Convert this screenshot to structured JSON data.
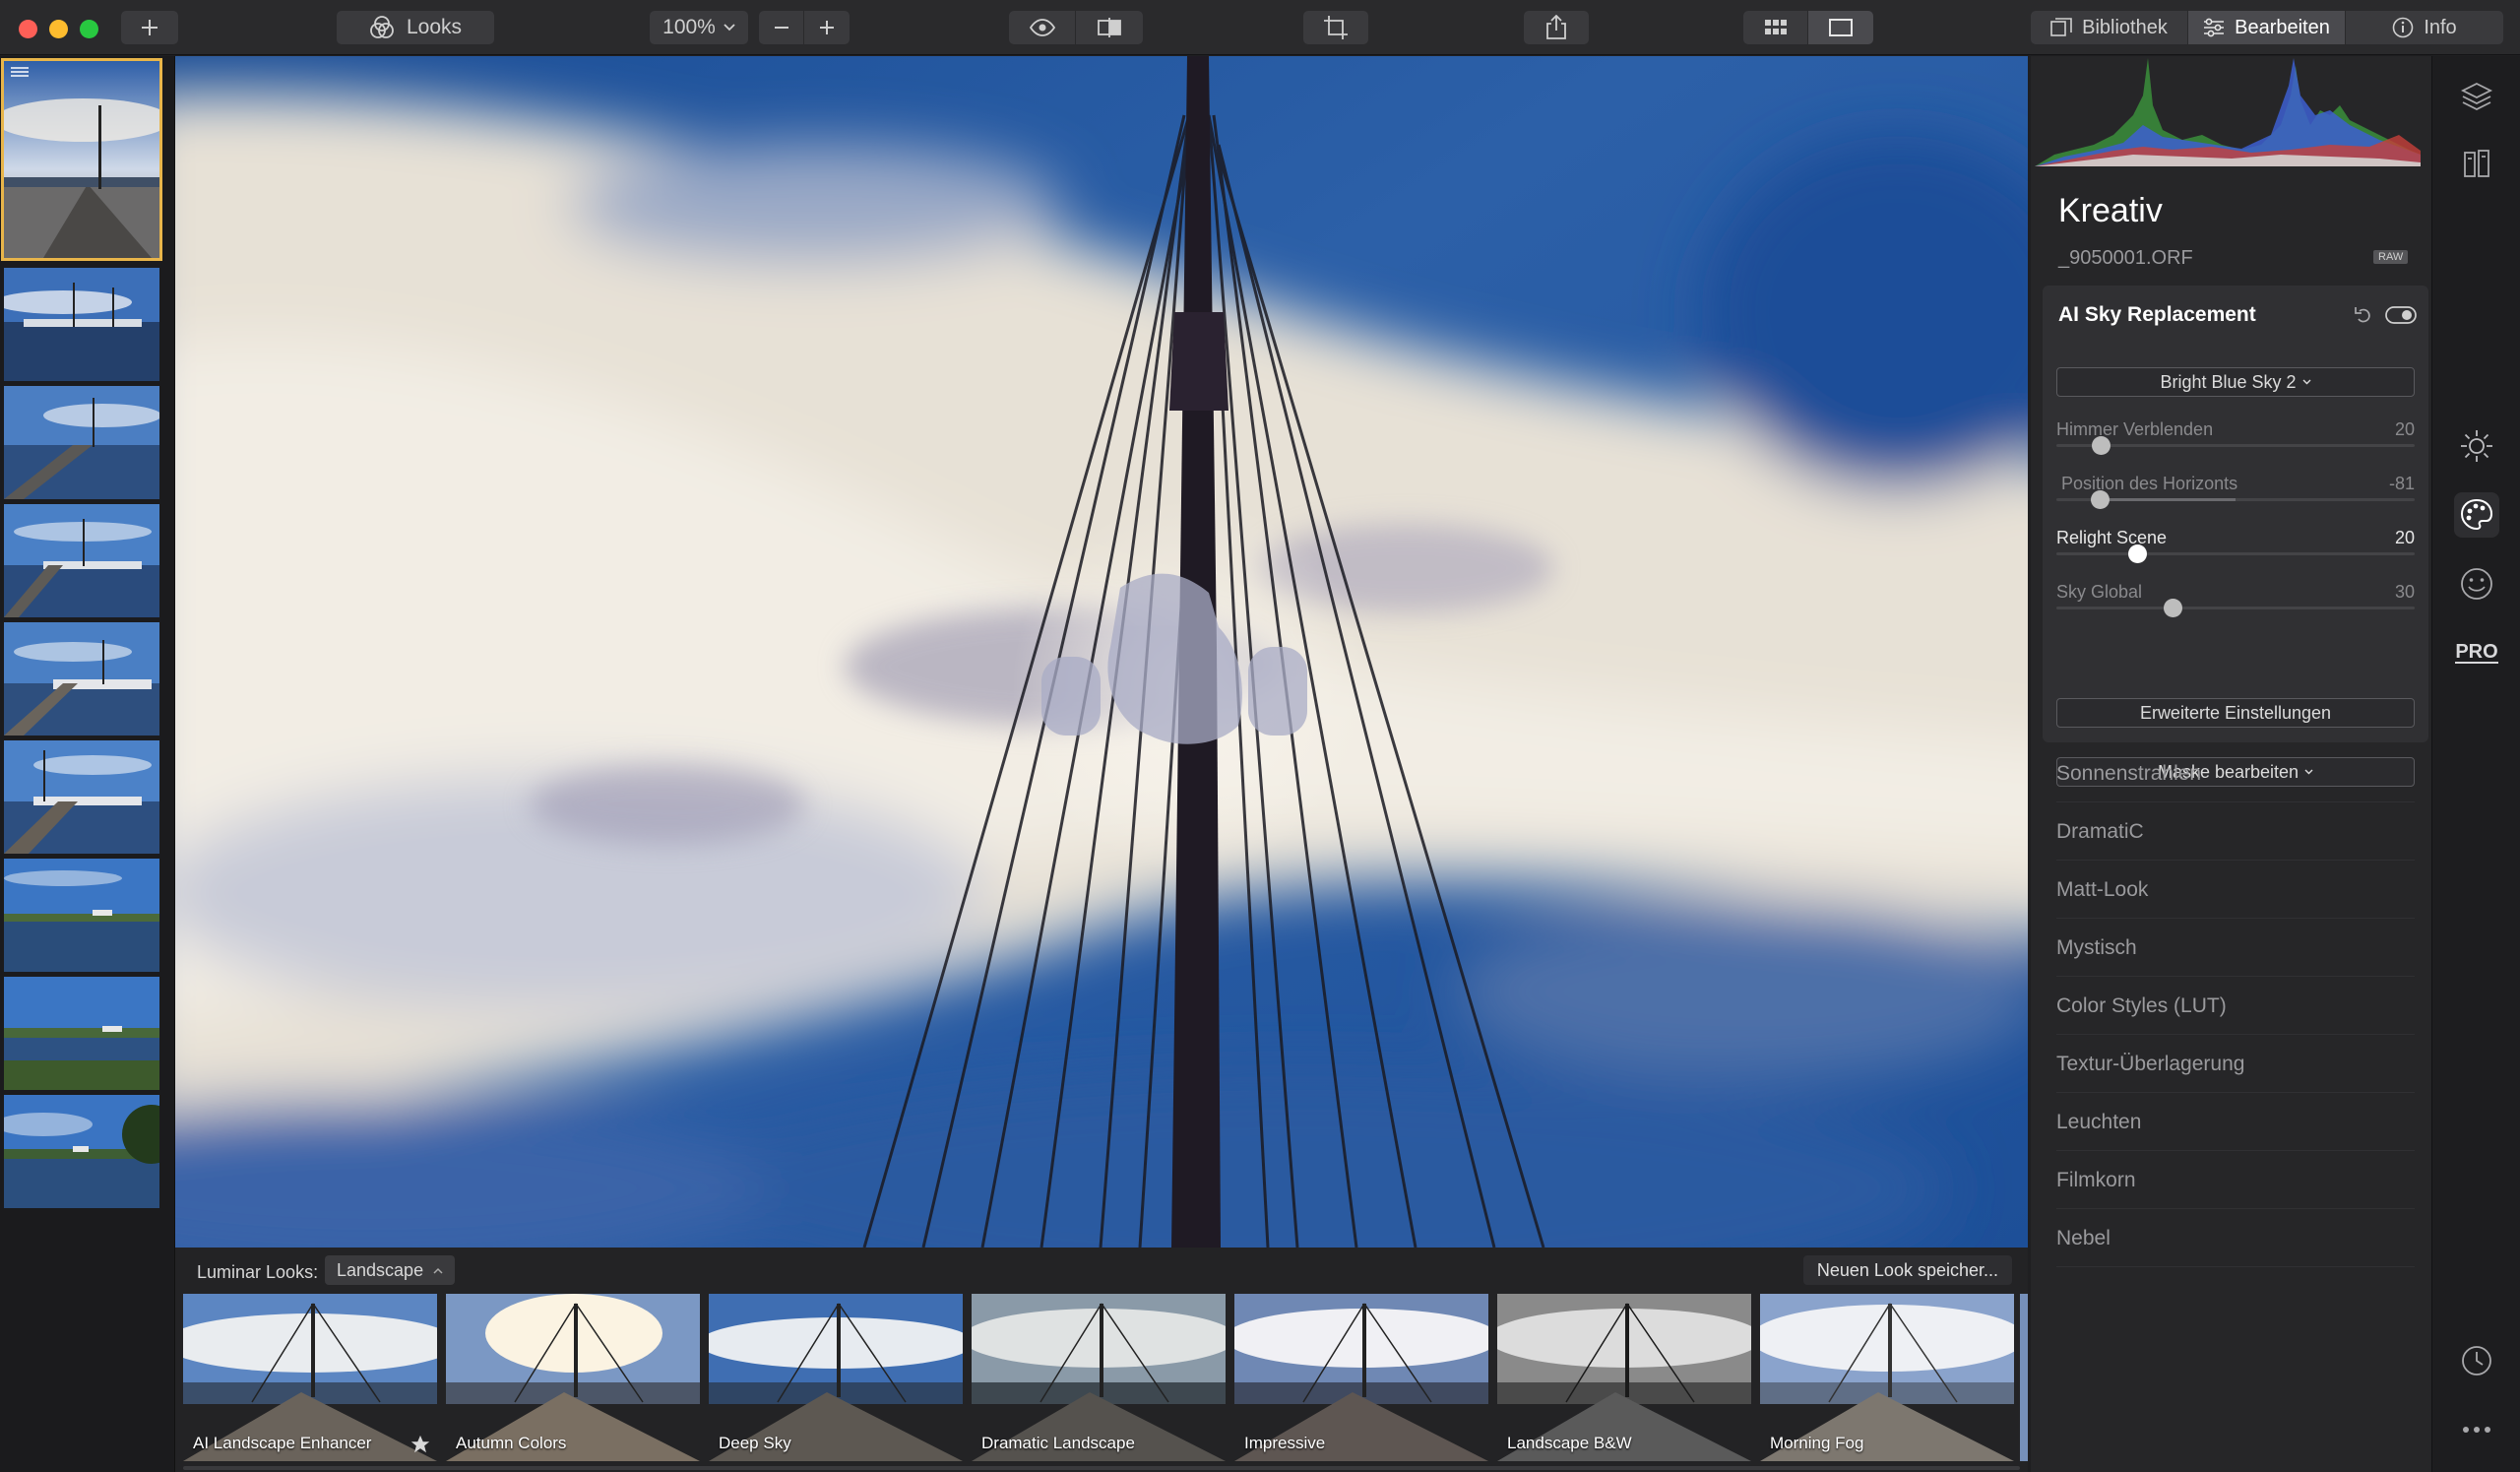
{
  "colors": {
    "accent": "#e8b54a",
    "close": "#fe5f57",
    "minimize": "#febc2e",
    "zoom": "#28c840"
  },
  "toolbar": {
    "looks_label": "Looks",
    "zoom_value": "100%",
    "tabs": [
      {
        "label": "Bibliothek",
        "active": false
      },
      {
        "label": "Bearbeiten",
        "active": true
      },
      {
        "label": "Info",
        "active": false
      }
    ],
    "icons": [
      "plus-icon",
      "looks-icon",
      "zoom-out-icon",
      "zoom-in-icon",
      "eye-icon",
      "compare-icon",
      "crop-icon",
      "share-icon",
      "grid-view-icon",
      "single-view-icon",
      "library-icon",
      "sliders-icon",
      "info-icon"
    ]
  },
  "filmstrip": {
    "count": 10,
    "selected_index": 0
  },
  "panel": {
    "section_title": "Kreativ",
    "filename": "_9050001.ORF",
    "raw_badge": "RAW",
    "filter": {
      "title": "AI Sky Replacement",
      "sky_select": "Bright Blue Sky 2",
      "sliders": [
        {
          "name": "Himmer Verblenden",
          "value": "20",
          "pos": 0.1,
          "highlight": false
        },
        {
          "name": "Position des Horizonts",
          "value": "-81",
          "pos": 0.095,
          "highlight": false
        },
        {
          "name": "Relight Scene",
          "value": "20",
          "pos": 0.2,
          "highlight": true
        },
        {
          "name": "Sky Global",
          "value": "30",
          "pos": 0.3,
          "highlight": false
        }
      ],
      "advanced_button": "Erweiterte Einstellungen",
      "mask_button": "Maske bearbeiten"
    },
    "filters": [
      "Sonnenstrahlen",
      "DramatiC",
      "Matt-Look",
      "Mystisch",
      "Color Styles (LUT)",
      "Textur-Überlagerung",
      "Leuchten",
      "Filmkorn",
      "Nebel"
    ]
  },
  "rail": {
    "icons": [
      "layers-icon",
      "presets-icon",
      "essentials-sun-icon",
      "creative-palette-icon",
      "portrait-face-icon",
      "pro-icon",
      "history-clock-icon",
      "more-icon"
    ],
    "pro_label": "PRO"
  },
  "looks": {
    "label": "Luminar Looks:",
    "category": "Landscape",
    "save_button": "Neuen Look speicher...",
    "items": [
      {
        "name": "AI Landscape Enhancer",
        "favorite": true
      },
      {
        "name": "Autumn Colors"
      },
      {
        "name": "Deep Sky"
      },
      {
        "name": "Dramatic Landscape"
      },
      {
        "name": "Impressive"
      },
      {
        "name": "Landscape B&W"
      },
      {
        "name": "Morning Fog"
      }
    ]
  }
}
